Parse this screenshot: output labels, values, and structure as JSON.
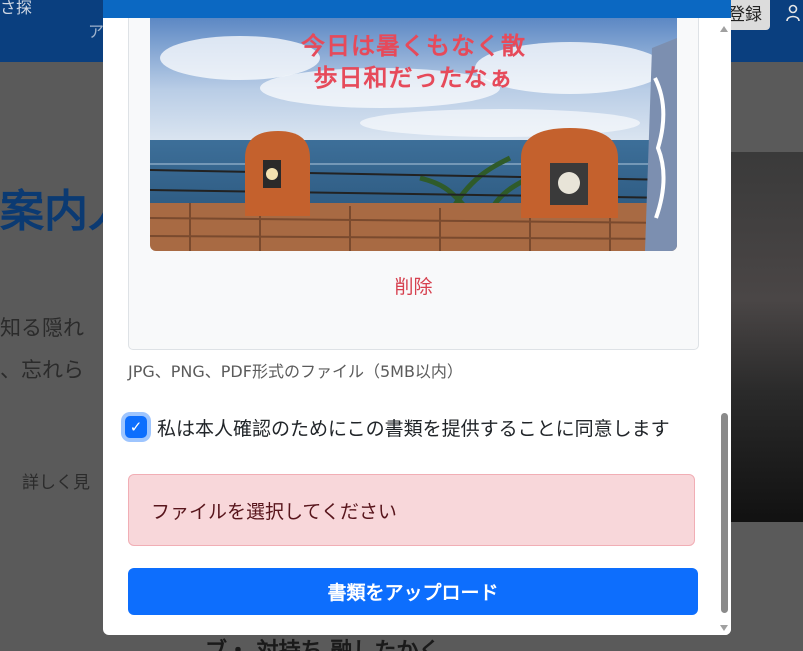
{
  "background": {
    "nav_fragment_left": "さ探",
    "nav_fragment_mid": "ア",
    "register_button": "登録",
    "heading_fragment": "案内人",
    "line1_fragment": "知る隠れ",
    "line2_fragment": "、忘れら",
    "link_fragment": "詳しく見",
    "bottom_fragment": "ブ・ 対持ち 融したかく"
  },
  "modal": {
    "image_caption_line1": "今日は暑くもなく散",
    "image_caption_line2": "歩日和だったなぁ",
    "delete_label": "削除",
    "help_text": "JPG、PNG、PDF形式のファイル（5MB以内）",
    "consent_label": "私は本人確認のためにこの書類を提供することに同意します",
    "consent_checked": true,
    "error_message": "ファイルを選択してください",
    "upload_button": "書類をアップロード"
  },
  "icons": {
    "checkbox": "check-icon",
    "user": "user-icon",
    "scroll_up": "chevron-up-icon",
    "scroll_down": "chevron-down-icon"
  },
  "colors": {
    "primary": "#0d6efd",
    "danger_text": "#d6414f",
    "alert_bg": "#f8d7da"
  }
}
